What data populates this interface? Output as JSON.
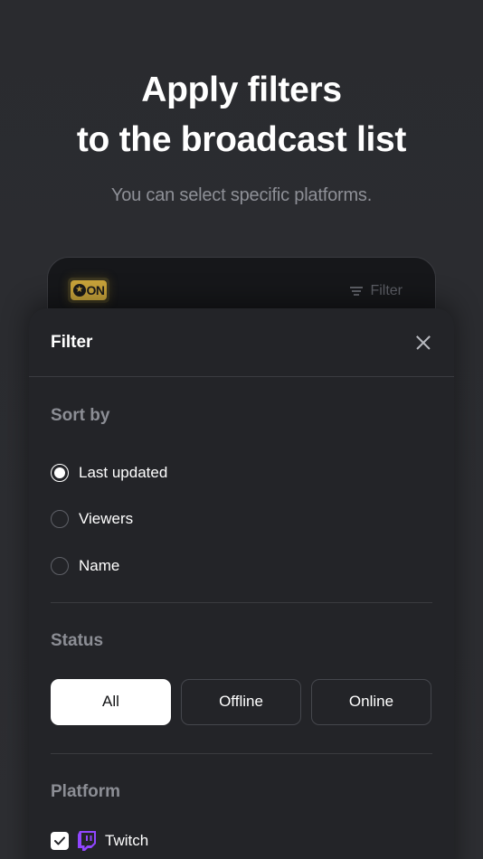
{
  "promo": {
    "headline_line1": "Apply filters",
    "headline_line2": "to the broadcast list",
    "subtitle": "You can select specific platforms."
  },
  "background_app": {
    "logo_text": "ON",
    "filter_label": "Filter"
  },
  "sheet": {
    "title": "Filter",
    "sort_by": {
      "title": "Sort by",
      "options": [
        {
          "label": "Last updated",
          "selected": true
        },
        {
          "label": "Viewers",
          "selected": false
        },
        {
          "label": "Name",
          "selected": false
        }
      ]
    },
    "status": {
      "title": "Status",
      "options": [
        {
          "label": "All",
          "active": true
        },
        {
          "label": "Offline",
          "active": false
        },
        {
          "label": "Online",
          "active": false
        }
      ]
    },
    "platform": {
      "title": "Platform",
      "items": [
        {
          "label": "Twitch",
          "checked": true,
          "icon": "twitch-icon"
        }
      ]
    }
  },
  "colors": {
    "background": "#2b2c30",
    "sheet": "#232428",
    "accent_twitch": "#9146ff",
    "logo_gold": "#c9a43a"
  }
}
